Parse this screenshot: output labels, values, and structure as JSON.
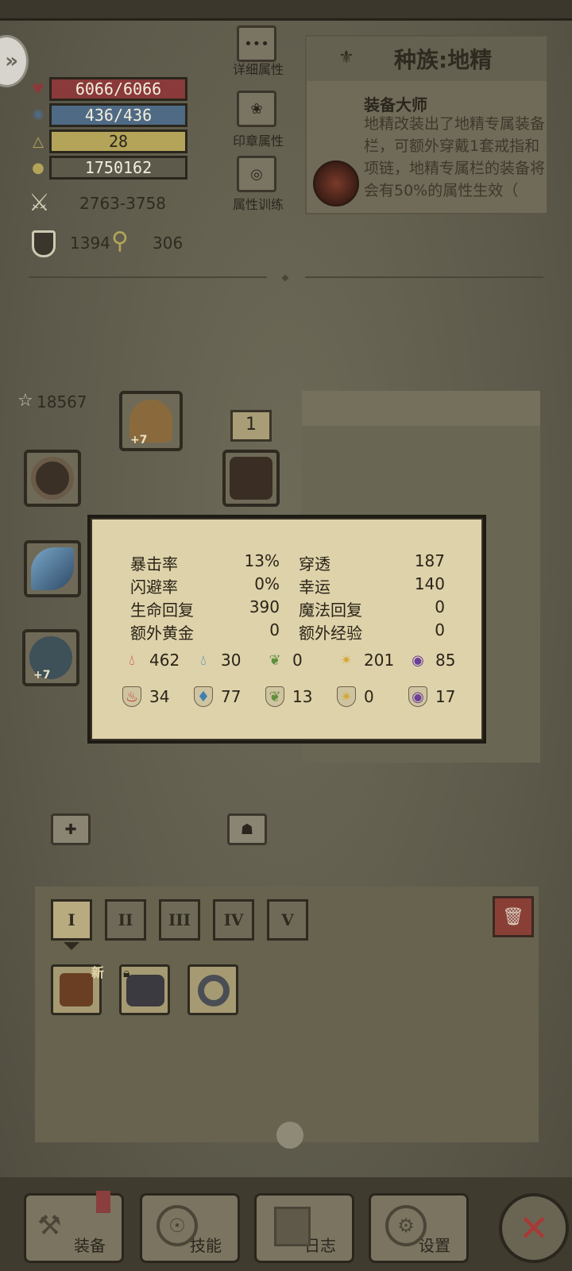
{
  "stats": {
    "hp": "6066/6066",
    "mp": "436/436",
    "level": "28",
    "gold": "1750162",
    "attack": "2763-3758",
    "armor": "1394",
    "magic_resist": "306"
  },
  "side_buttons": {
    "detail": "详细属性",
    "seal": "印章属性",
    "training": "属性训练"
  },
  "race": {
    "title": "种族:地精",
    "skill_name": "装备大师",
    "skill_desc": "地精改装出了地精专属装备栏，可额外穿戴1套戒指和项链，地精专属栏的装备将会有50%的属性生效（"
  },
  "equipment": {
    "score": "18567",
    "count_box": "1",
    "plus_helmet": "+7",
    "plus_ring": "+7"
  },
  "tooltip": {
    "rows": [
      {
        "l": "暴击率",
        "v": "13%",
        "l2": "穿透",
        "v2": "187"
      },
      {
        "l": "闪避率",
        "v": "0%",
        "l2": "幸运",
        "v2": "140"
      },
      {
        "l": "生命回复",
        "v": "390",
        "l2": "魔法回复",
        "v2": "0"
      },
      {
        "l": "额外黄金",
        "v": "0",
        "l2": "额外经验",
        "v2": "0"
      }
    ],
    "elem_attack": [
      "462",
      "30",
      "0",
      "201",
      "85"
    ],
    "elem_resist": [
      "34",
      "77",
      "13",
      "0",
      "17"
    ]
  },
  "inventory": {
    "tabs": [
      "I",
      "II",
      "III",
      "IV",
      "V"
    ],
    "new_tag": "新"
  },
  "nav": {
    "equip": "装备",
    "skill": "技能",
    "log": "日志",
    "settings": "设置"
  },
  "colors": {
    "fire": "#c0392b",
    "water": "#3f7fb0",
    "nature": "#5f8f3c",
    "light": "#d4a52a",
    "arcane": "#6b3f9a"
  }
}
